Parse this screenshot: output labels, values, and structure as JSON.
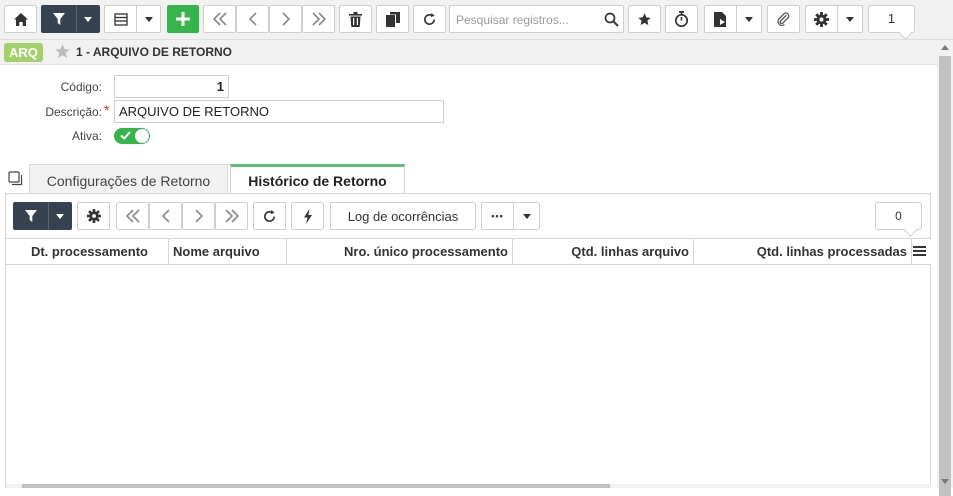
{
  "toolbar": {
    "search_placeholder": "Pesquisar registros...",
    "page_number": "1",
    "icons": [
      "home-icon",
      "filter-icon",
      "grid-view-icon",
      "add-icon",
      "first-icon",
      "prev-icon",
      "next-icon",
      "last-icon",
      "trash-icon",
      "copy-icon",
      "refresh-icon",
      "search-icon",
      "star-icon",
      "stopwatch-icon",
      "report-icon",
      "paperclip-icon",
      "gear-icon"
    ]
  },
  "header": {
    "badge": "ARQ",
    "title": "1 - ARQUIVO DE RETORNO"
  },
  "form": {
    "codigo_label": "Código:",
    "codigo_value": "1",
    "descricao_label": "Descrição:",
    "descricao_required": "*",
    "descricao_value": "ARQUIVO DE RETORNO",
    "ativa_label": "Ativa:",
    "ativa_value": "on"
  },
  "tabs": [
    {
      "label": "Configurações de Retorno",
      "active": false
    },
    {
      "label": "Histórico de Retorno",
      "active": true
    }
  ],
  "panel": {
    "log_button": "Log de ocorrências",
    "more_button": "•••",
    "record_count": "0",
    "columns": [
      "Dt. processamento",
      "Nome arquivo",
      "Nro. único processamento",
      "Qtd. linhas arquivo",
      "Qtd. linhas processadas"
    ]
  },
  "colors": {
    "dark_button": "#36424f",
    "add_button": "#36b54a",
    "badge": "#a4d06a",
    "active_tab": "#5cbf72",
    "toggle_on": "#36b54a"
  }
}
